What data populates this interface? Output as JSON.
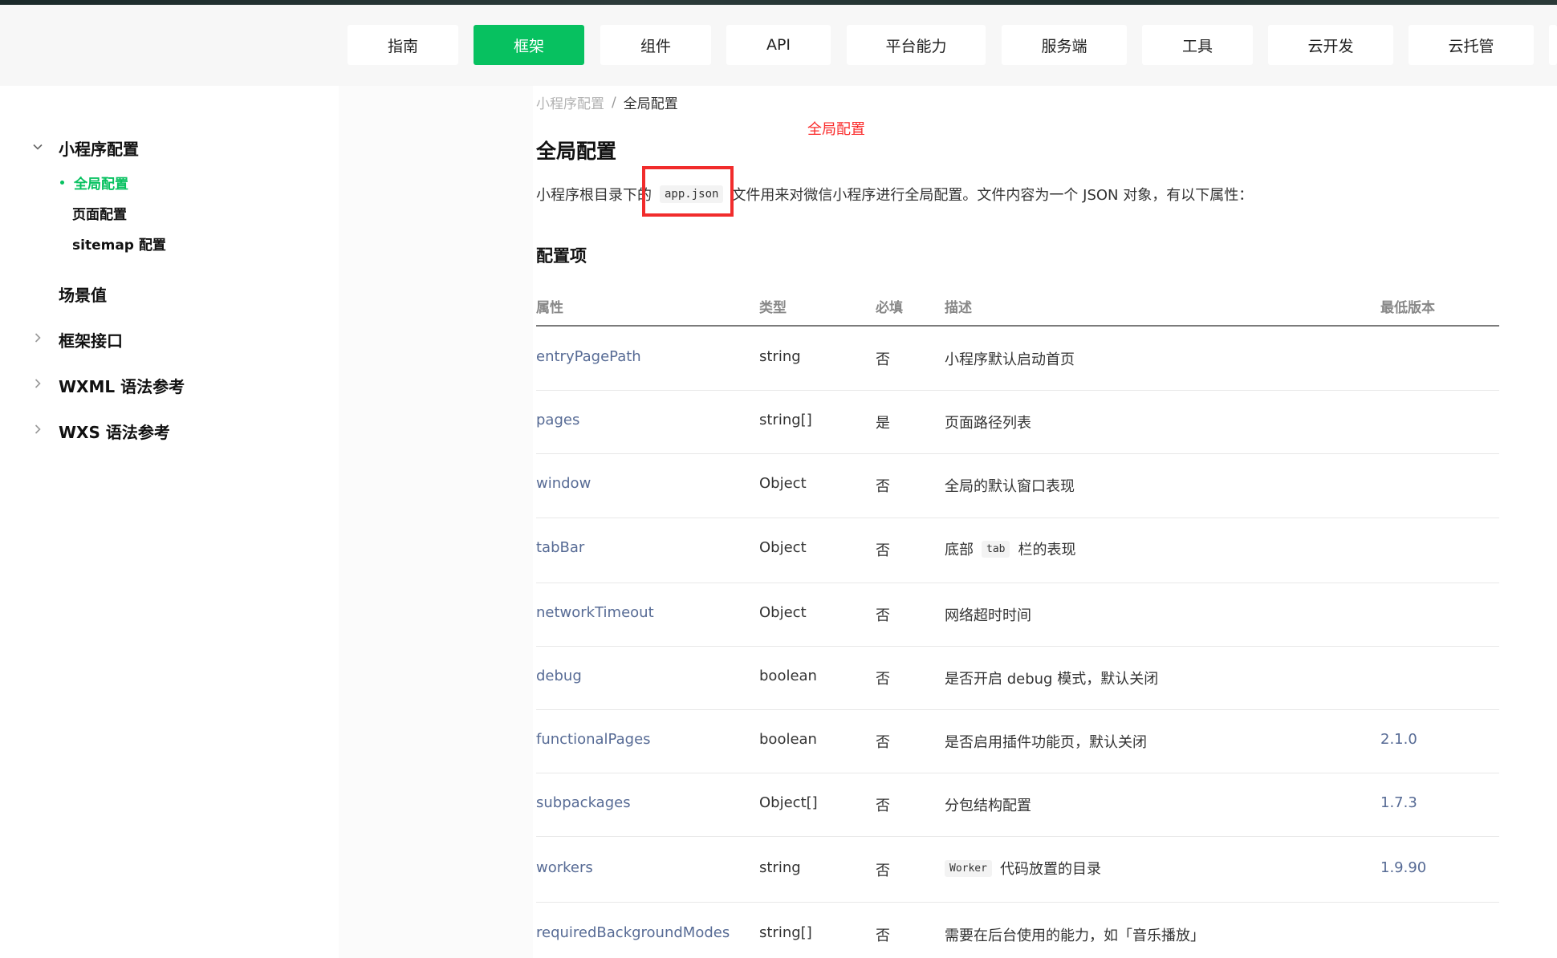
{
  "nav": {
    "items": [
      {
        "label": "指南"
      },
      {
        "label": "框架",
        "active": true
      },
      {
        "label": "组件"
      },
      {
        "label": "API"
      },
      {
        "label": "平台能力"
      },
      {
        "label": "服务端"
      },
      {
        "label": "工具"
      },
      {
        "label": "云开发"
      },
      {
        "label": "云托管"
      }
    ]
  },
  "sidebar": {
    "groups": [
      {
        "label": "小程序配置",
        "expanded": true,
        "icon": "chevron-down-icon",
        "children": [
          {
            "label": "全局配置",
            "active": true
          },
          {
            "label": "页面配置"
          },
          {
            "label": "sitemap 配置"
          }
        ]
      },
      {
        "label": "场景值"
      },
      {
        "label": "框架接口",
        "icon": "chevron-right-icon"
      },
      {
        "label": "WXML 语法参考",
        "icon": "chevron-right-icon"
      },
      {
        "label": "WXS 语法参考",
        "icon": "chevron-right-icon"
      }
    ]
  },
  "breadcrumb": {
    "parent": "小程序配置",
    "separator": "/",
    "current": "全局配置"
  },
  "annotation": "全局配置",
  "page": {
    "title": "全局配置",
    "intro_before": "小程序根目录下的",
    "intro_code": "app.json",
    "intro_after": "文件用来对微信小程序进行全局配置。文件内容为一个 JSON 对象，有以下属性：",
    "section_title": "配置项"
  },
  "table": {
    "headers": {
      "attr": "属性",
      "type": "类型",
      "required": "必填",
      "desc": "描述",
      "version": "最低版本"
    },
    "rows": [
      {
        "attr": "entryPagePath",
        "type": "string",
        "required": "否",
        "desc": "小程序默认启动首页",
        "version": ""
      },
      {
        "attr": "pages",
        "type": "string[]",
        "required": "是",
        "desc": "页面路径列表",
        "version": ""
      },
      {
        "attr": "window",
        "type": "Object",
        "required": "否",
        "desc": "全局的默认窗口表现",
        "version": ""
      },
      {
        "attr": "tabBar",
        "type": "Object",
        "required": "否",
        "desc_pre": "底部",
        "desc_code": "tab",
        "desc_post": "栏的表现",
        "version": ""
      },
      {
        "attr": "networkTimeout",
        "type": "Object",
        "required": "否",
        "desc": "网络超时时间",
        "version": ""
      },
      {
        "attr": "debug",
        "type": "boolean",
        "required": "否",
        "desc": "是否开启 debug 模式，默认关闭",
        "version": ""
      },
      {
        "attr": "functionalPages",
        "type": "boolean",
        "required": "否",
        "desc": "是否启用插件功能页，默认关闭",
        "version": "2.1.0"
      },
      {
        "attr": "subpackages",
        "type": "Object[]",
        "required": "否",
        "desc": "分包结构配置",
        "version": "1.7.3"
      },
      {
        "attr": "workers",
        "type": "string",
        "required": "否",
        "desc_code": "Worker",
        "desc_post": "代码放置的目录",
        "version": "1.9.90"
      },
      {
        "attr": "requiredBackgroundModes",
        "type": "string[]",
        "required": "否",
        "desc": "需要在后台使用的能力，如「音乐播放」",
        "version": ""
      }
    ]
  },
  "colors": {
    "accent": "#07c160",
    "link": "#576b95",
    "annotation": "#fa2b2b"
  }
}
